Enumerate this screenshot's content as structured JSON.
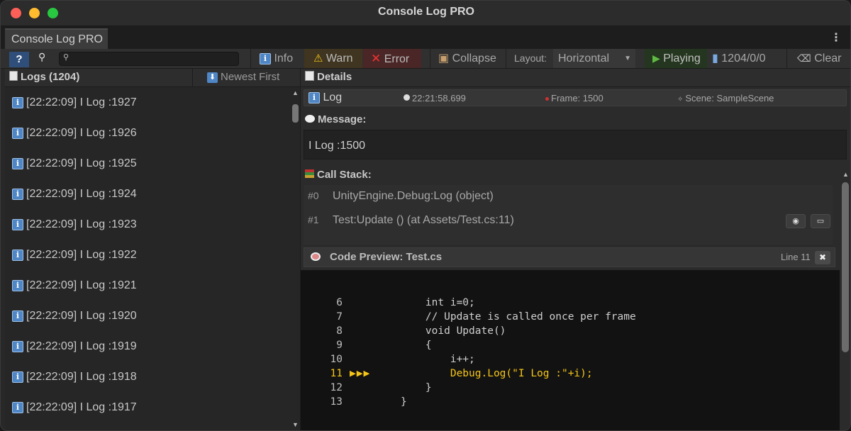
{
  "window": {
    "title": "Console Log PRO"
  },
  "tab": {
    "label": "Console Log PRO",
    "menu": "⋮"
  },
  "toolbar": {
    "help": "?",
    "search": {
      "value": "",
      "placeholder": ""
    },
    "info": "Info",
    "warn": "Warn",
    "error": "Error",
    "collapse": "Collapse",
    "layout_label": "Layout:",
    "layout_value": "Horizontal",
    "playing": "Playing",
    "counts": "1204/0/0",
    "clear": "Clear"
  },
  "logs_panel": {
    "title": "Logs (1204)",
    "sort": "Newest First",
    "items": [
      {
        "text": "[22:22:09] I Log :1927"
      },
      {
        "text": "[22:22:09] I Log :1926"
      },
      {
        "text": "[22:22:09] I Log :1925"
      },
      {
        "text": "[22:22:09] I Log :1924"
      },
      {
        "text": "[22:22:09] I Log :1923"
      },
      {
        "text": "[22:22:09] I Log :1922"
      },
      {
        "text": "[22:22:09] I Log :1921"
      },
      {
        "text": "[22:22:09] I Log :1920"
      },
      {
        "text": "[22:22:09] I Log :1919"
      },
      {
        "text": "[22:22:09] I Log :1918"
      },
      {
        "text": "[22:22:09] I Log :1917"
      }
    ]
  },
  "details": {
    "title": "Details",
    "level": "Log",
    "time": "22:21:58.699",
    "frame": "Frame: 1500",
    "scene": "Scene: SampleScene",
    "message_label": "Message:",
    "message": "I Log :1500",
    "callstack_label": "Call Stack:",
    "frames": [
      {
        "index": "#0",
        "text": "UnityEngine.Debug:Log (object)"
      },
      {
        "index": "#1",
        "text": "Test:Update () (at Assets/Test.cs:11)"
      }
    ],
    "code_preview": {
      "label": "Code Preview: Test.cs",
      "line_label": "Line 11",
      "close": "✖",
      "marker": "▶▶▶",
      "lines": [
        {
          "num": "6",
          "text": "    int i=0;"
        },
        {
          "num": "7",
          "text": "    // Update is called once per frame"
        },
        {
          "num": "8",
          "text": "    void Update()"
        },
        {
          "num": "9",
          "text": "    {"
        },
        {
          "num": "10",
          "text": "        i++;"
        },
        {
          "num": "11",
          "text": "        Debug.Log(\"I Log :\"+i);"
        },
        {
          "num": "12",
          "text": "    }"
        },
        {
          "num": "13",
          "text": "}"
        }
      ]
    }
  },
  "colors": {
    "accent": "#4f86c6",
    "highlight": "#f5c518",
    "error": "#e33333",
    "play": "#5fba44"
  }
}
